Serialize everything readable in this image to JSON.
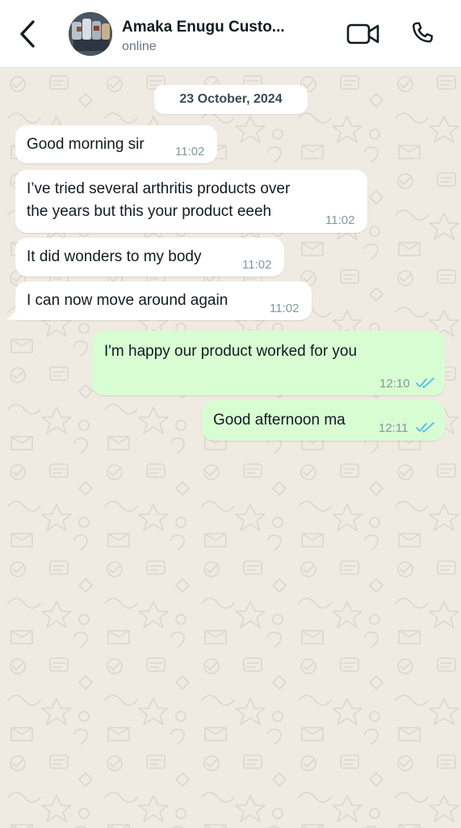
{
  "header": {
    "contact_name": "Amaka Enugu Custo...",
    "status": "online",
    "back_icon": "chevron-left-icon",
    "video_icon": "video-camera-icon",
    "call_icon": "phone-icon"
  },
  "chat": {
    "date_label": "23 October, 2024",
    "messages": [
      {
        "direction": "incoming",
        "text": "Good morning sir",
        "time": "11:02"
      },
      {
        "direction": "incoming",
        "text": "I’ve tried several arthritis products over\nthe years but this your product eeeh",
        "time": "11:02"
      },
      {
        "direction": "incoming",
        "text": "It did wonders to my body",
        "time": "11:02"
      },
      {
        "direction": "incoming",
        "text": "I can now move around again",
        "time": "11:02"
      },
      {
        "direction": "outgoing",
        "text": "I'm happy our product worked for you",
        "time": "12:10",
        "status": "read"
      },
      {
        "direction": "outgoing",
        "text": "Good afternoon ma",
        "time": "12:11",
        "status": "read"
      }
    ]
  },
  "colors": {
    "incoming_bubble": "#ffffff",
    "outgoing_bubble": "#d9fdd3",
    "read_tick": "#53bdeb",
    "wallpaper": "#efeae2"
  }
}
